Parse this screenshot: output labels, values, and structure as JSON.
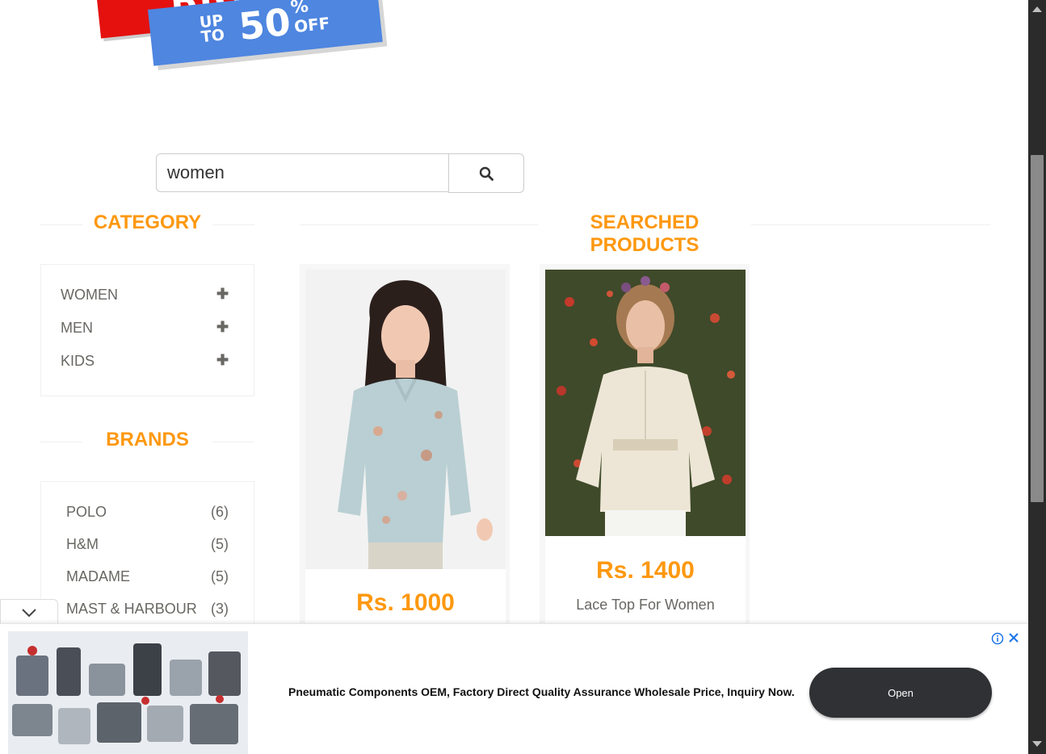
{
  "banner": {
    "title": "BIG SALE",
    "up_to": "UP TO",
    "percent": "50",
    "percent_sign": "%",
    "off": "OFF"
  },
  "search": {
    "value": "women",
    "icon": "search-icon"
  },
  "category": {
    "heading": "CATEGORY",
    "items": [
      {
        "label": "WOMEN",
        "icon": "plus-icon"
      },
      {
        "label": "MEN",
        "icon": "plus-icon"
      },
      {
        "label": "KIDS",
        "icon": "plus-icon"
      }
    ]
  },
  "brands": {
    "heading": "BRANDS",
    "items": [
      {
        "name": "POLO",
        "count": "(6)"
      },
      {
        "name": "H&M",
        "count": "(5)"
      },
      {
        "name": "MADAME",
        "count": "(5)"
      },
      {
        "name": "MAST & HARBOUR",
        "count": "(3)"
      }
    ]
  },
  "products": {
    "heading": "SEARCHED PRODUCTS",
    "items": [
      {
        "price": "Rs. 1000",
        "name": ""
      },
      {
        "price": "Rs. 1400",
        "name": "Lace Top For Women"
      }
    ]
  },
  "ad": {
    "text": "Pneumatic Components OEM, Factory Direct Quality Assurance Wholesale Price, Inquiry Now.",
    "button": "Open",
    "info_icon": "info-icon",
    "close_icon": "close-icon"
  },
  "colors": {
    "accent": "#fe980f",
    "sale_red": "#e4110f",
    "sale_blue": "#4e86e0",
    "text": "#696763"
  }
}
